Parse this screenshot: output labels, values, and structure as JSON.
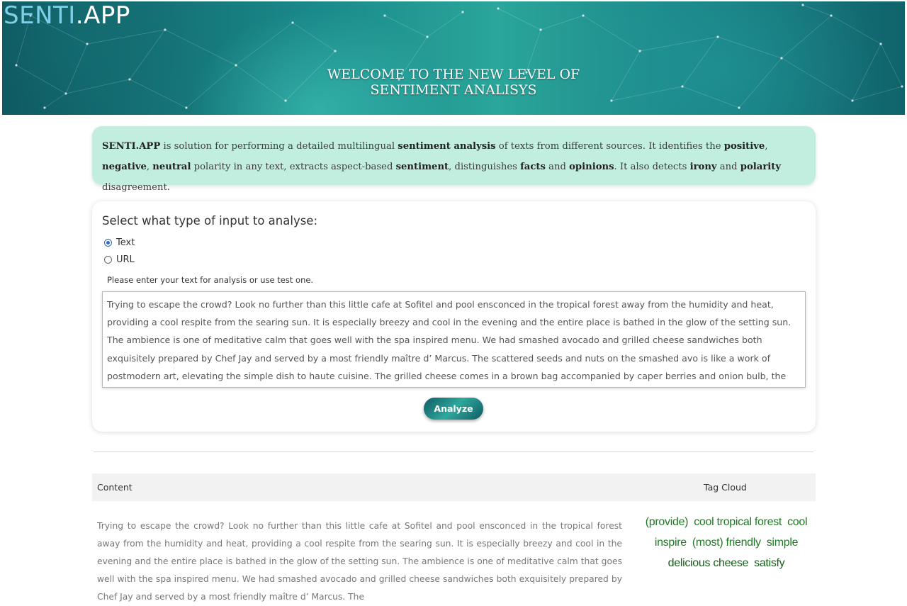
{
  "header": {
    "logo_part1": "SENTI",
    "logo_part2": ".APP",
    "headline_line1": "WELCOME TO THE NEW LEVEL OF",
    "headline_line2": "SENTIMENT ANALISYS"
  },
  "intro": {
    "t1": "SENTI.APP",
    "t2": " is solution for performing a detailed multilingual ",
    "t3": "sentiment analysis",
    "t4": " of texts from different sources. It identifies the ",
    "t5": "positive",
    "t6": ", ",
    "t7": "negative",
    "t8": ", ",
    "t9": "neutral",
    "t10": " polarity in any text, extracts aspect-based ",
    "t11": "sentiment",
    "t12": ", distinguishes ",
    "t13": "facts",
    "t14": " and ",
    "t15": "opinions",
    "t16": ". It also detects ",
    "t17": "irony",
    "t18": " and ",
    "t19": "polarity",
    "t20": " disagreement."
  },
  "input": {
    "title": "Select what type of input to analyse:",
    "options": [
      {
        "label": "Text",
        "selected": true
      },
      {
        "label": "URL",
        "selected": false
      }
    ],
    "hint": "Please enter your text for analysis or use test one.",
    "text": "Trying to escape the  crowd? Look no further than this little cafe at Sofitel and pool ensconced in the tropical forest away from the humidity and heat, providing a cool respite from the searing sun. It is especially breezy and cool in the evening and the entire place is bathed in the glow of the setting sun. The ambience is one of meditative calm that goes well with the spa inspired menu. We had smashed avocado and grilled cheese sandwiches both exquisitely prepared by Chef Jay and served by a most friendly maître d’ Marcus. The scattered seeds and nuts on the smashed avo is like a work of postmodern art, elevating the simple dish to haute cuisine. The grilled cheese comes in a brown bag accompanied by caper berries and onion bulb, the sharp preserves accentuated the three cheeses between the toast… inexplicably delicious and satisfying…",
    "analyze_label": "Analyze"
  },
  "results": {
    "col_content": "Content",
    "col_tags": "Tag Cloud",
    "content_text": "Trying to escape the crowd? Look no further than this little cafe at Sofitel and pool ensconced in the tropical forest away from the humidity and heat, providing a cool respite from the searing sun. It is especially breezy and cool in the evening and the entire place is bathed in the glow of the setting sun. The ambience is one of meditative calm that goes well with the spa inspired menu. We had smashed avocado and grilled cheese sandwiches both exquisitely prepared by Chef Jay and served by a most friendly maître d’ Marcus. The",
    "tags": [
      "(provide)",
      "cool tropical forest",
      "cool",
      "inspire",
      "(most) friendly",
      "simple",
      "delicious cheese",
      "satisfy"
    ]
  },
  "colors": {
    "intro_bg": "#c2eee0",
    "tag_green": "#1e7a22",
    "banner_teal": "#1a8a8a"
  }
}
